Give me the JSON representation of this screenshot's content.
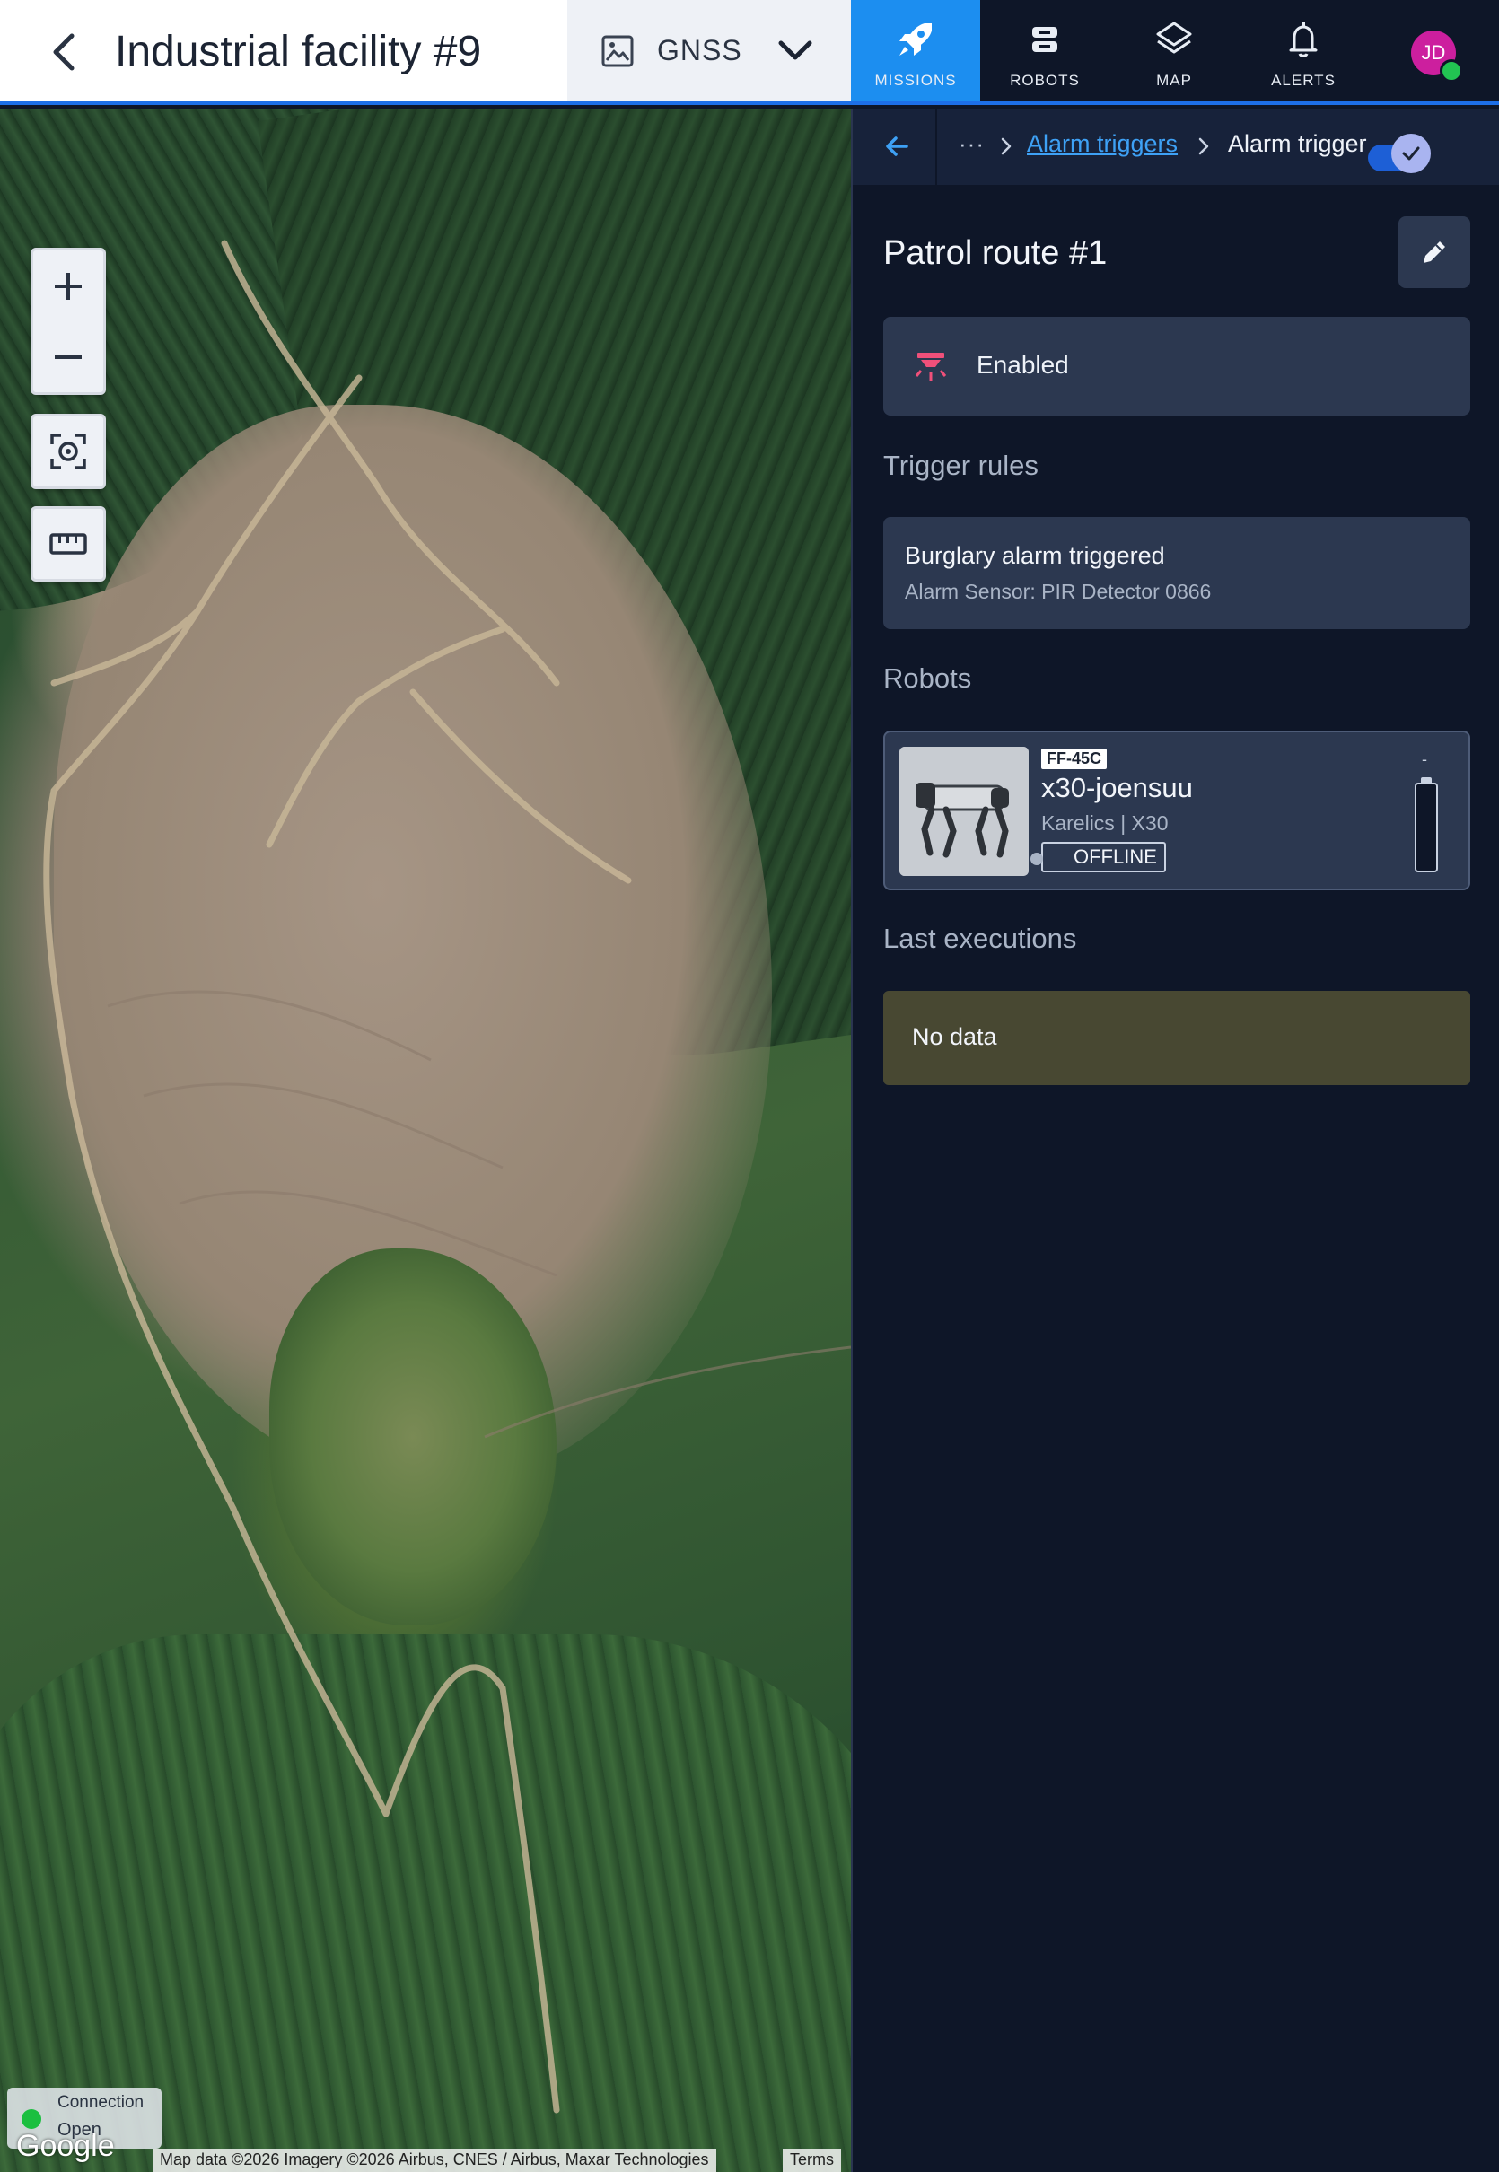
{
  "header": {
    "title": "Industrial facility #9",
    "layer_select": {
      "value": "GNSS"
    }
  },
  "nav": {
    "items": [
      {
        "label": "MISSIONS",
        "icon": "rocket-icon",
        "active": true
      },
      {
        "label": "ROBOTS",
        "icon": "robot-icon",
        "active": false
      },
      {
        "label": "MAP",
        "icon": "layers-icon",
        "active": false
      },
      {
        "label": "ALERTS",
        "icon": "bell-icon",
        "active": false
      }
    ],
    "avatar": {
      "initials": "JD",
      "status_color": "#22c452"
    }
  },
  "map": {
    "connection": {
      "title": "Connection",
      "status": "Open"
    },
    "google_logo": "Google",
    "attribution": "Map data ©2026 Imagery ©2026 Airbus, CNES / Airbus, Maxar Technologies",
    "terms": "Terms"
  },
  "breadcrumb": {
    "more": "···",
    "link": "Alarm triggers",
    "current": "Alarm trigger"
  },
  "trigger": {
    "name": "Patrol route #1",
    "enabled_label": "Enabled",
    "enabled": true
  },
  "sections": {
    "trigger_rules": "Trigger rules",
    "robots": "Robots",
    "last_executions": "Last executions"
  },
  "rules": [
    {
      "title": "Burglary alarm triggered",
      "subtitle": "Alarm Sensor: PIR Detector 0866"
    }
  ],
  "robots": [
    {
      "tag": "FF-45C",
      "name": "x30-joensuu",
      "model": "Karelics | X30",
      "status": "OFFLINE",
      "battery": "-"
    }
  ],
  "executions": {
    "empty_label": "No data"
  },
  "colors": {
    "accent": "#1c8ef0",
    "panel_bg": "#0e1628",
    "card_bg": "#2c3850",
    "nodata_bg": "#484832",
    "alarm_icon": "#f0507a"
  }
}
